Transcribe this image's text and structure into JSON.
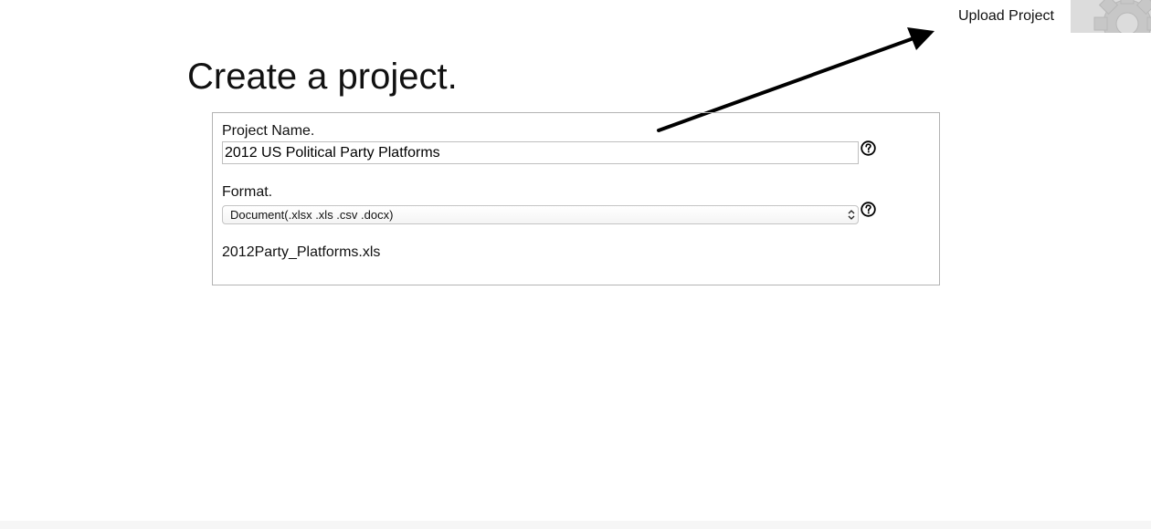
{
  "header": {
    "upload_label": "Upload Project",
    "settings_icon": "gear-icon"
  },
  "page": {
    "title": "Create a project."
  },
  "form": {
    "project_name_label": "Project Name.",
    "project_name_value": "2012 US Political Party Platforms",
    "format_label": "Format.",
    "format_selected": "Document(.xlsx .xls .csv .docx)",
    "file_name": "2012Party_Platforms.xls",
    "help_icon": "question-circle-icon"
  },
  "annotation": {
    "arrow_icon": "arrow-icon",
    "arrow_color": "#000000"
  },
  "colors": {
    "background": "#ffffff",
    "panel_border": "#b3b3b3",
    "gear_tile": "#dcdcdc"
  }
}
